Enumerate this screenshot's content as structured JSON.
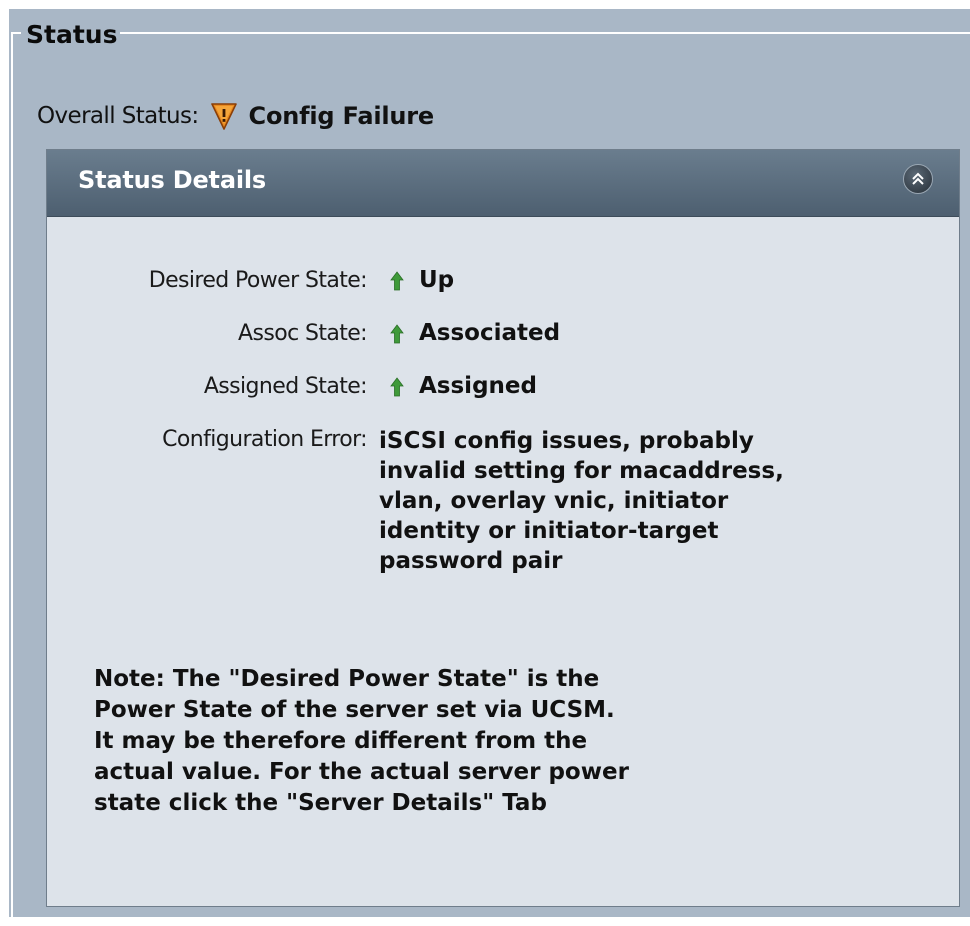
{
  "status": {
    "legend": "Status",
    "overall_label": "Overall Status:",
    "overall_value": "Config Failure",
    "overall_icon": "warning-shield-icon",
    "overall_icon_color": "#e07b1a"
  },
  "details": {
    "title": "Status Details",
    "collapse_icon": "double-chevron-up-icon",
    "rows": [
      {
        "label": "Desired Power State:",
        "value": "Up",
        "icon": "up-arrow-icon"
      },
      {
        "label": "Assoc State:",
        "value": "Associated",
        "icon": "up-arrow-icon"
      },
      {
        "label": "Assigned State:",
        "value": "Assigned",
        "icon": "up-arrow-icon"
      }
    ],
    "config_error_label": "Configuration Error:",
    "config_error_lines": [
      "iSCSI config issues, probably",
      "invalid setting for macaddress,",
      "vlan, overlay vnic, initiator",
      "identity or initiator-target",
      "password pair"
    ],
    "note_lines": [
      "Note: The \"Desired Power State\" is the",
      "Power State of the server set via UCSM.",
      "It may be therefore different from the",
      "actual value. For the actual server power",
      "state click the \"Server Details\" Tab"
    ]
  },
  "colors": {
    "outer_background": "#a9b7c6",
    "panel_background": "#dde3ea",
    "header_background": "#566879",
    "arrow_green": "#3f9a3a"
  }
}
